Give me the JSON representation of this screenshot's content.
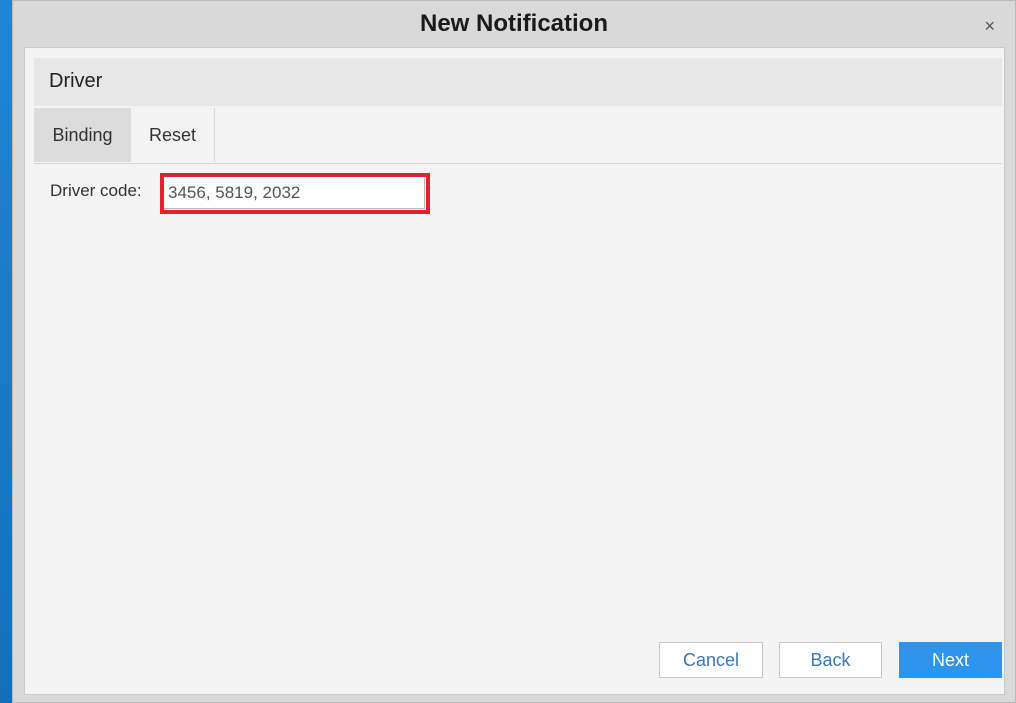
{
  "window": {
    "title": "New Notification",
    "close_icon": "close-icon",
    "close_glyph": "×"
  },
  "section": {
    "title": "Driver"
  },
  "tabs": [
    {
      "label": "Binding",
      "active": true
    },
    {
      "label": "Reset",
      "active": false
    }
  ],
  "form": {
    "driver_code_label": "Driver code:",
    "driver_code_value": "3456, 5819, 2032"
  },
  "footer": {
    "cancel_label": "Cancel",
    "back_label": "Back",
    "next_label": "Next"
  },
  "colors": {
    "accent": "#2d95ee",
    "highlight": "#e3202e"
  }
}
